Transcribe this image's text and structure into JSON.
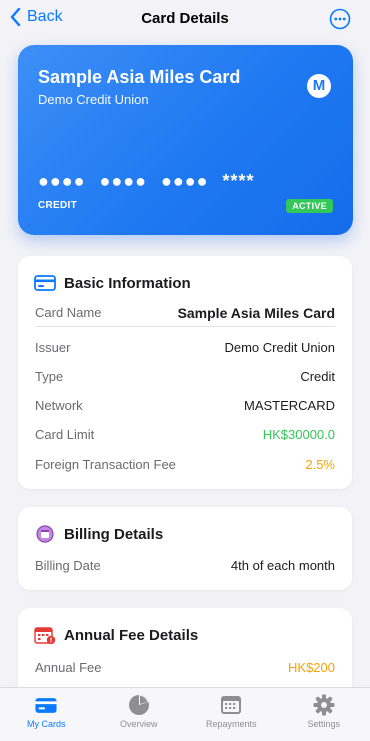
{
  "nav": {
    "back_label": "Back",
    "title": "Card Details"
  },
  "card": {
    "name": "Sample Asia Miles Card",
    "issuer": "Demo Credit Union",
    "logo_letter": "M",
    "number": "●●●● ●●●● ●●●● ****",
    "type": "CREDIT",
    "status": "ACTIVE",
    "colors": {
      "gradient_start": "#3e8ff7",
      "gradient_end": "#156cec",
      "status": "#34c759"
    }
  },
  "basic": {
    "title": "Basic Information",
    "rows": [
      {
        "label": "Card Name",
        "value": "Sample Asia Miles Card"
      },
      {
        "label": "Issuer",
        "value": "Demo Credit Union"
      },
      {
        "label": "Type",
        "value": "Credit"
      },
      {
        "label": "Network",
        "value": "MASTERCARD"
      },
      {
        "label": "Card Limit",
        "value": "HK$30000.0"
      },
      {
        "label": "Foreign Transaction Fee",
        "value": "2.5%"
      }
    ]
  },
  "billing": {
    "title": "Billing Details",
    "rows": [
      {
        "label": "Billing Date",
        "value": "4th of each month"
      }
    ]
  },
  "annual": {
    "title": "Annual Fee Details",
    "rows": [
      {
        "label": "Annual Fee",
        "value": "HK$200"
      }
    ]
  },
  "tabs": [
    {
      "label": "My Cards",
      "icon": "card-icon",
      "active": true
    },
    {
      "label": "Overview",
      "icon": "pie-chart-icon"
    },
    {
      "label": "Repayments",
      "icon": "calendar-icon"
    },
    {
      "label": "Settings",
      "icon": "gear-icon"
    }
  ],
  "colors": {
    "accent": "#0a7aff",
    "positive": "#34c759",
    "warning": "#f5a30a"
  }
}
